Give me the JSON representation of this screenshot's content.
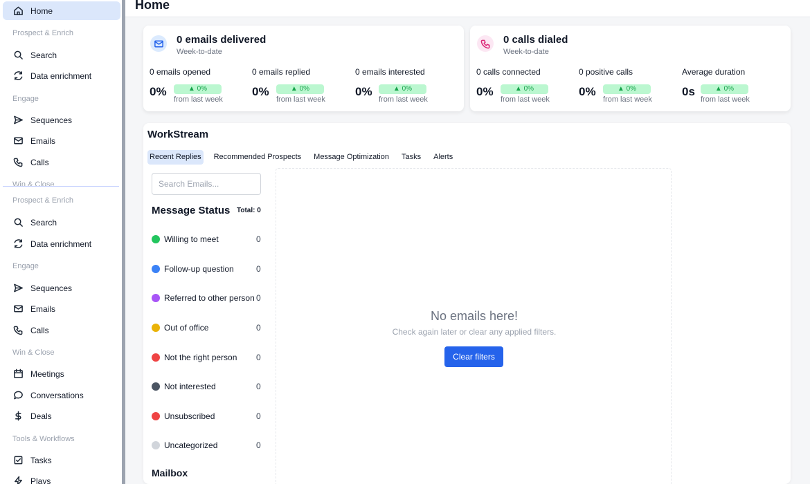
{
  "sidebar": {
    "home": "Home",
    "sections": {
      "prospect": "Prospect & Enrich",
      "engage": "Engage",
      "win": "Win & Close",
      "tools": "Tools & Workflows"
    },
    "items": {
      "search": "Search",
      "data_enrichment": "Data enrichment",
      "sequences": "Sequences",
      "emails": "Emails",
      "calls": "Calls",
      "meetings": "Meetings",
      "conversations": "Conversations",
      "deals": "Deals",
      "tasks": "Tasks",
      "plays": "Plays"
    }
  },
  "header": {
    "title": "Home"
  },
  "email_card": {
    "title": "0 emails delivered",
    "subtitle": "Week-to-date",
    "metrics": [
      {
        "label": "0 emails opened",
        "value": "0%",
        "change": "▲ 0%",
        "from": "from last week"
      },
      {
        "label": "0 emails replied",
        "value": "0%",
        "change": "▲ 0%",
        "from": "from last week"
      },
      {
        "label": "0 emails interested",
        "value": "0%",
        "change": "▲ 0%",
        "from": "from last week"
      }
    ]
  },
  "calls_card": {
    "title": "0 calls dialed",
    "subtitle": "Week-to-date",
    "metrics": [
      {
        "label": "0 calls connected",
        "value": "0%",
        "change": "▲ 0%",
        "from": "from last week"
      },
      {
        "label": "0 positive calls",
        "value": "0%",
        "change": "▲ 0%",
        "from": "from last week"
      },
      {
        "label": "Average duration",
        "value": "0s",
        "change": "▲ 0%",
        "from": "from last week"
      }
    ]
  },
  "workstream": {
    "title": "WorkStream",
    "tabs": [
      "Recent Replies",
      "Recommended Prospects",
      "Message Optimization",
      "Tasks",
      "Alerts"
    ],
    "search_placeholder": "Search Emails...",
    "status_title": "Message Status",
    "total": "Total: 0",
    "statuses": [
      {
        "label": "Willing to meet",
        "count": "0",
        "color": "#22c55e"
      },
      {
        "label": "Follow-up question",
        "count": "0",
        "color": "#3b82f6"
      },
      {
        "label": "Referred to other person",
        "count": "0",
        "color": "#a855f7"
      },
      {
        "label": "Out of office",
        "count": "0",
        "color": "#eab308"
      },
      {
        "label": "Not the right person",
        "count": "0",
        "color": "#ef4444"
      },
      {
        "label": "Not interested",
        "count": "0",
        "color": "#4b5563"
      },
      {
        "label": "Unsubscribed",
        "count": "0",
        "color": "#ef4444"
      },
      {
        "label": "Uncategorized",
        "count": "0",
        "color": "#d1d5db"
      }
    ],
    "mailbox": "Mailbox",
    "empty_title": "No emails here!",
    "empty_sub": "Check again later or clear any applied filters.",
    "clear_button": "Clear filters"
  },
  "colors": {
    "accent": "#2563eb",
    "active_bg": "#dbe7fb",
    "positive": "#16a34a"
  }
}
